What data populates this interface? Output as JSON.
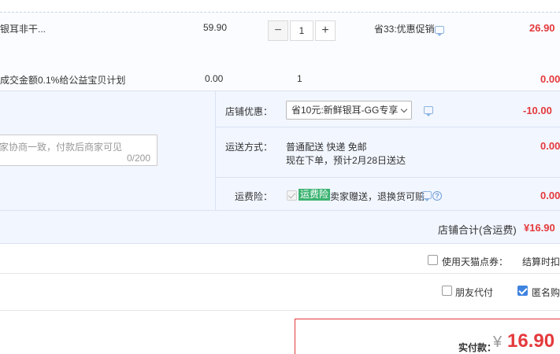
{
  "items": [
    {
      "title": "银耳非干...",
      "unit_price": "59.90",
      "quantity": "1",
      "promo": "省33:优惠促销",
      "subtotal": "26.90",
      "minus_icon": "minus-icon",
      "plus_icon": "plus-icon"
    },
    {
      "title": "成交金额0.1%给公益宝贝计划",
      "unit_price": "0.00",
      "quantity": "1",
      "subtotal": "0.00"
    }
  ],
  "message": {
    "placeholder": "家协商一致，付款后商家可见",
    "count": "0/200"
  },
  "shop_discount": {
    "label": "店铺优惠：",
    "selected": "省10元:新鲜银耳-GG专享",
    "amount": "-10.00"
  },
  "shipping": {
    "label": "运送方式：",
    "method": "普通配送 快递 免邮",
    "eta": "现在下单，预计2月28日送达",
    "amount": "0.00"
  },
  "insurance": {
    "label": "运费险：",
    "badge": "运费险",
    "desc": "卖家赠送，退换货可赔",
    "amount": "0.00"
  },
  "shop_total": {
    "label": "店铺合计(含运费)",
    "amount": "¥16.90"
  },
  "tmall_points": {
    "label": "使用天猫点券：",
    "note": "结算时扣除"
  },
  "options": {
    "friend_pay": "朋友代付",
    "anonymous": "匿名购买"
  },
  "checkout": {
    "label": "实付款：",
    "currency": "¥",
    "amount": "16.90"
  },
  "colors": {
    "accent_red": "#e4393c",
    "badge_green": "#3cb371",
    "check_blue": "#3f83e0"
  }
}
